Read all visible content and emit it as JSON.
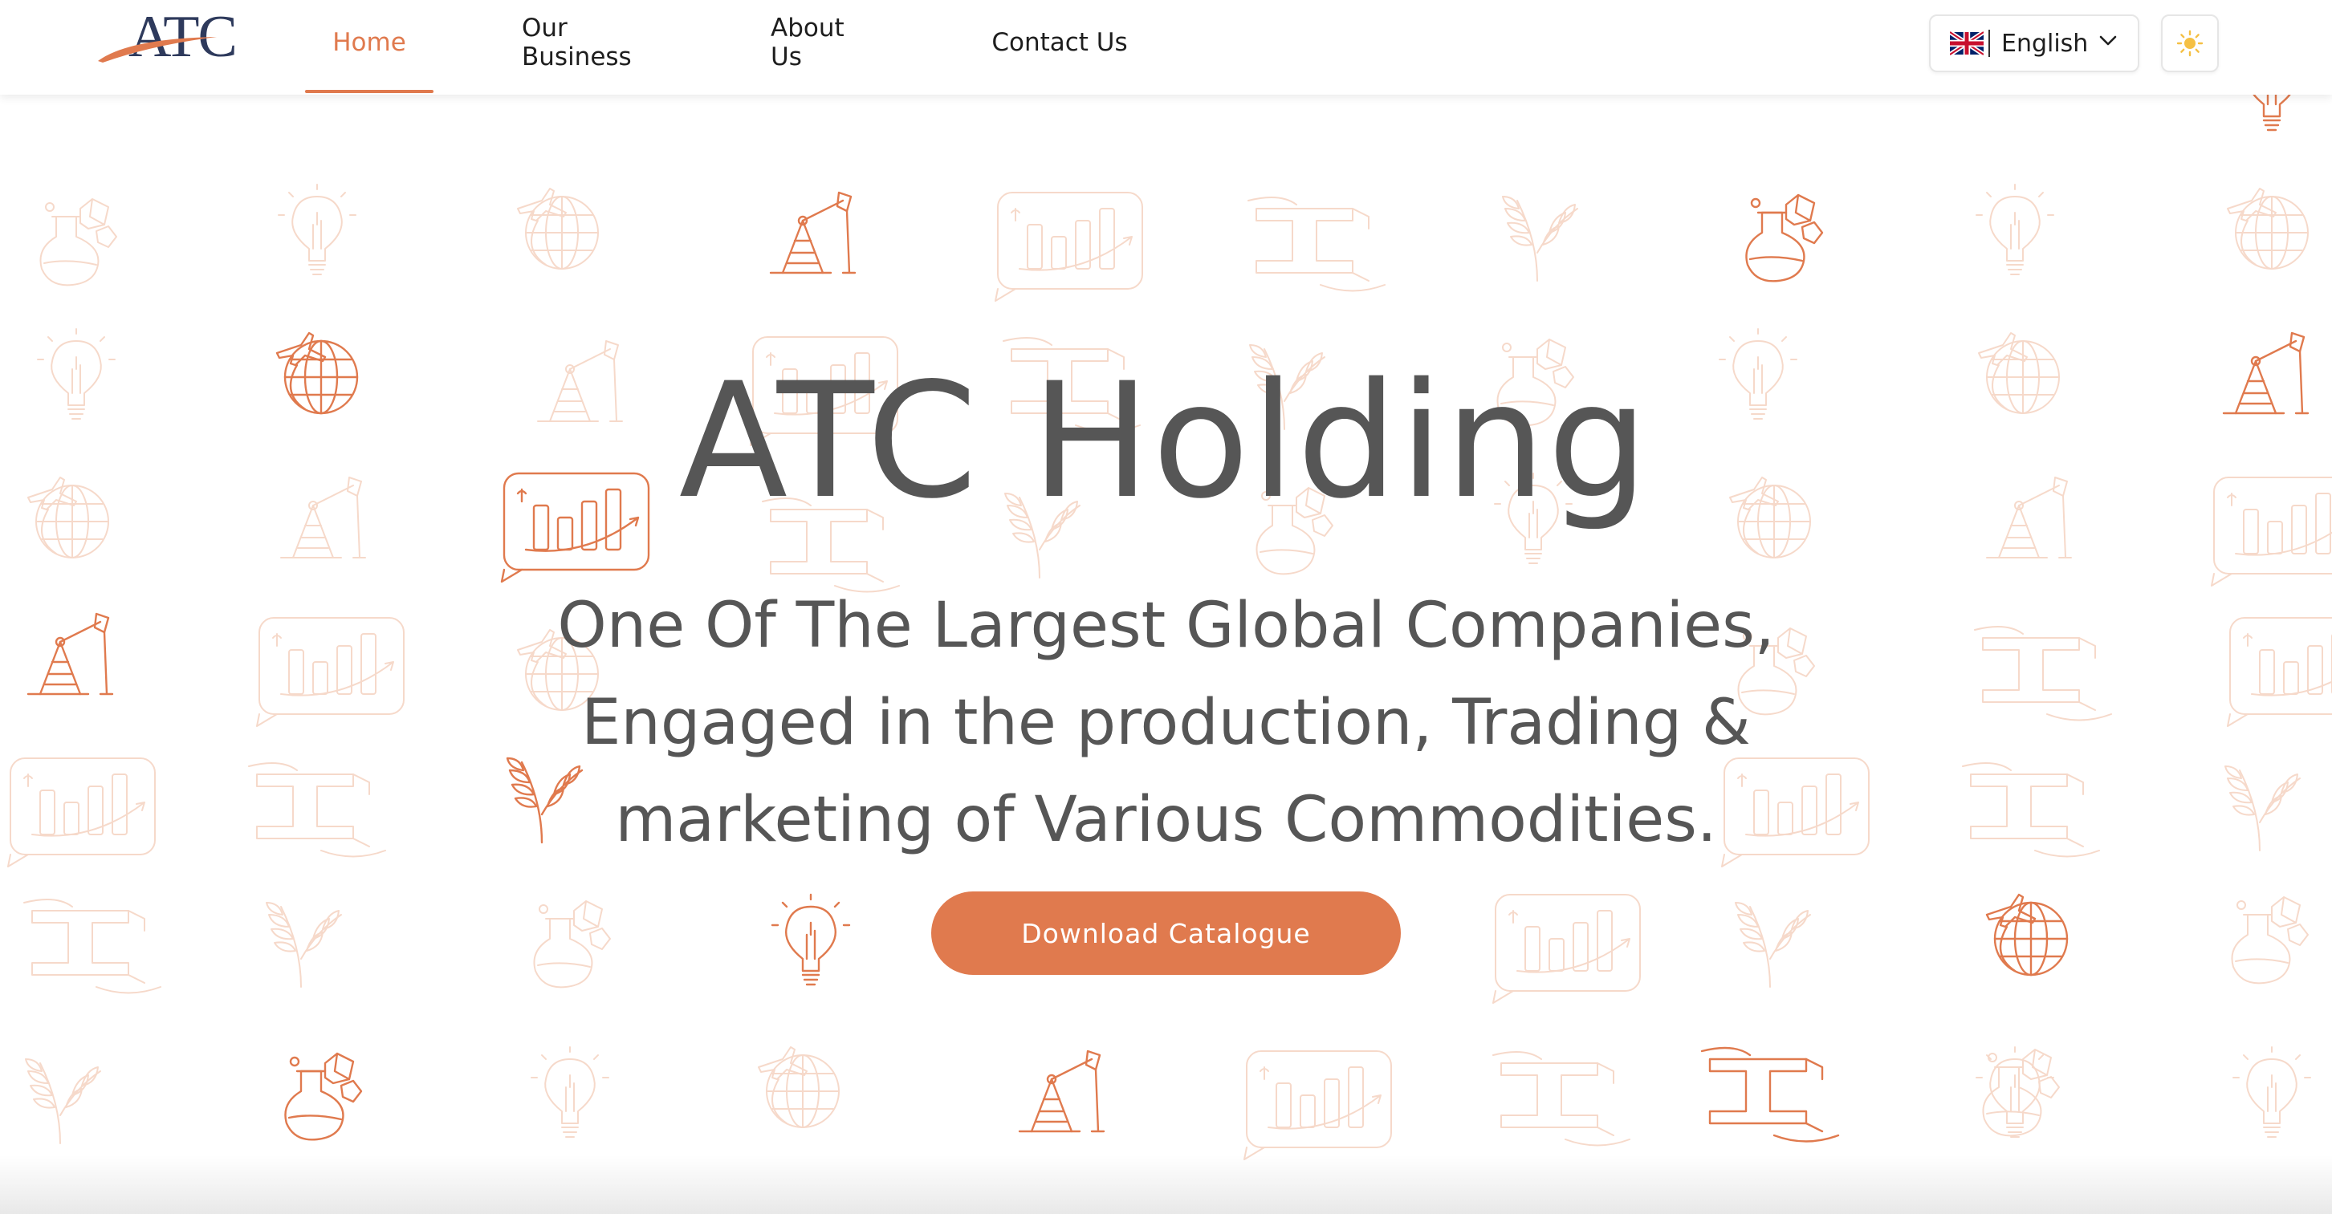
{
  "brand": {
    "logo_text": "ATC",
    "accent_color": "#e07a4e",
    "logo_text_color": "#2e3a5c"
  },
  "nav": {
    "items": [
      {
        "label": "Home",
        "active": true
      },
      {
        "label": "Our Business",
        "active": false
      },
      {
        "label": "About Us",
        "active": false
      },
      {
        "label": "Contact Us",
        "active": false
      }
    ]
  },
  "language": {
    "selected": "English",
    "flag_icon": "uk-flag-icon",
    "chevron_icon": "chevron-down-icon"
  },
  "theme_toggle": {
    "icon": "sun-icon",
    "icon_color": "#f5c044"
  },
  "hero": {
    "title": "ATC Holding",
    "subtitle_lines": [
      "One Of The Largest Global Companies,",
      "Engaged in the production, Trading &",
      "marketing of Various Commodities."
    ],
    "cta_label": "Download Catalogue"
  },
  "background": {
    "pattern_icons": [
      "oil-pump-icon",
      "globe-plane-icon",
      "bar-chart-icon",
      "lightbulb-icon",
      "flask-icon",
      "wheat-icon",
      "steel-beam-icon"
    ]
  }
}
